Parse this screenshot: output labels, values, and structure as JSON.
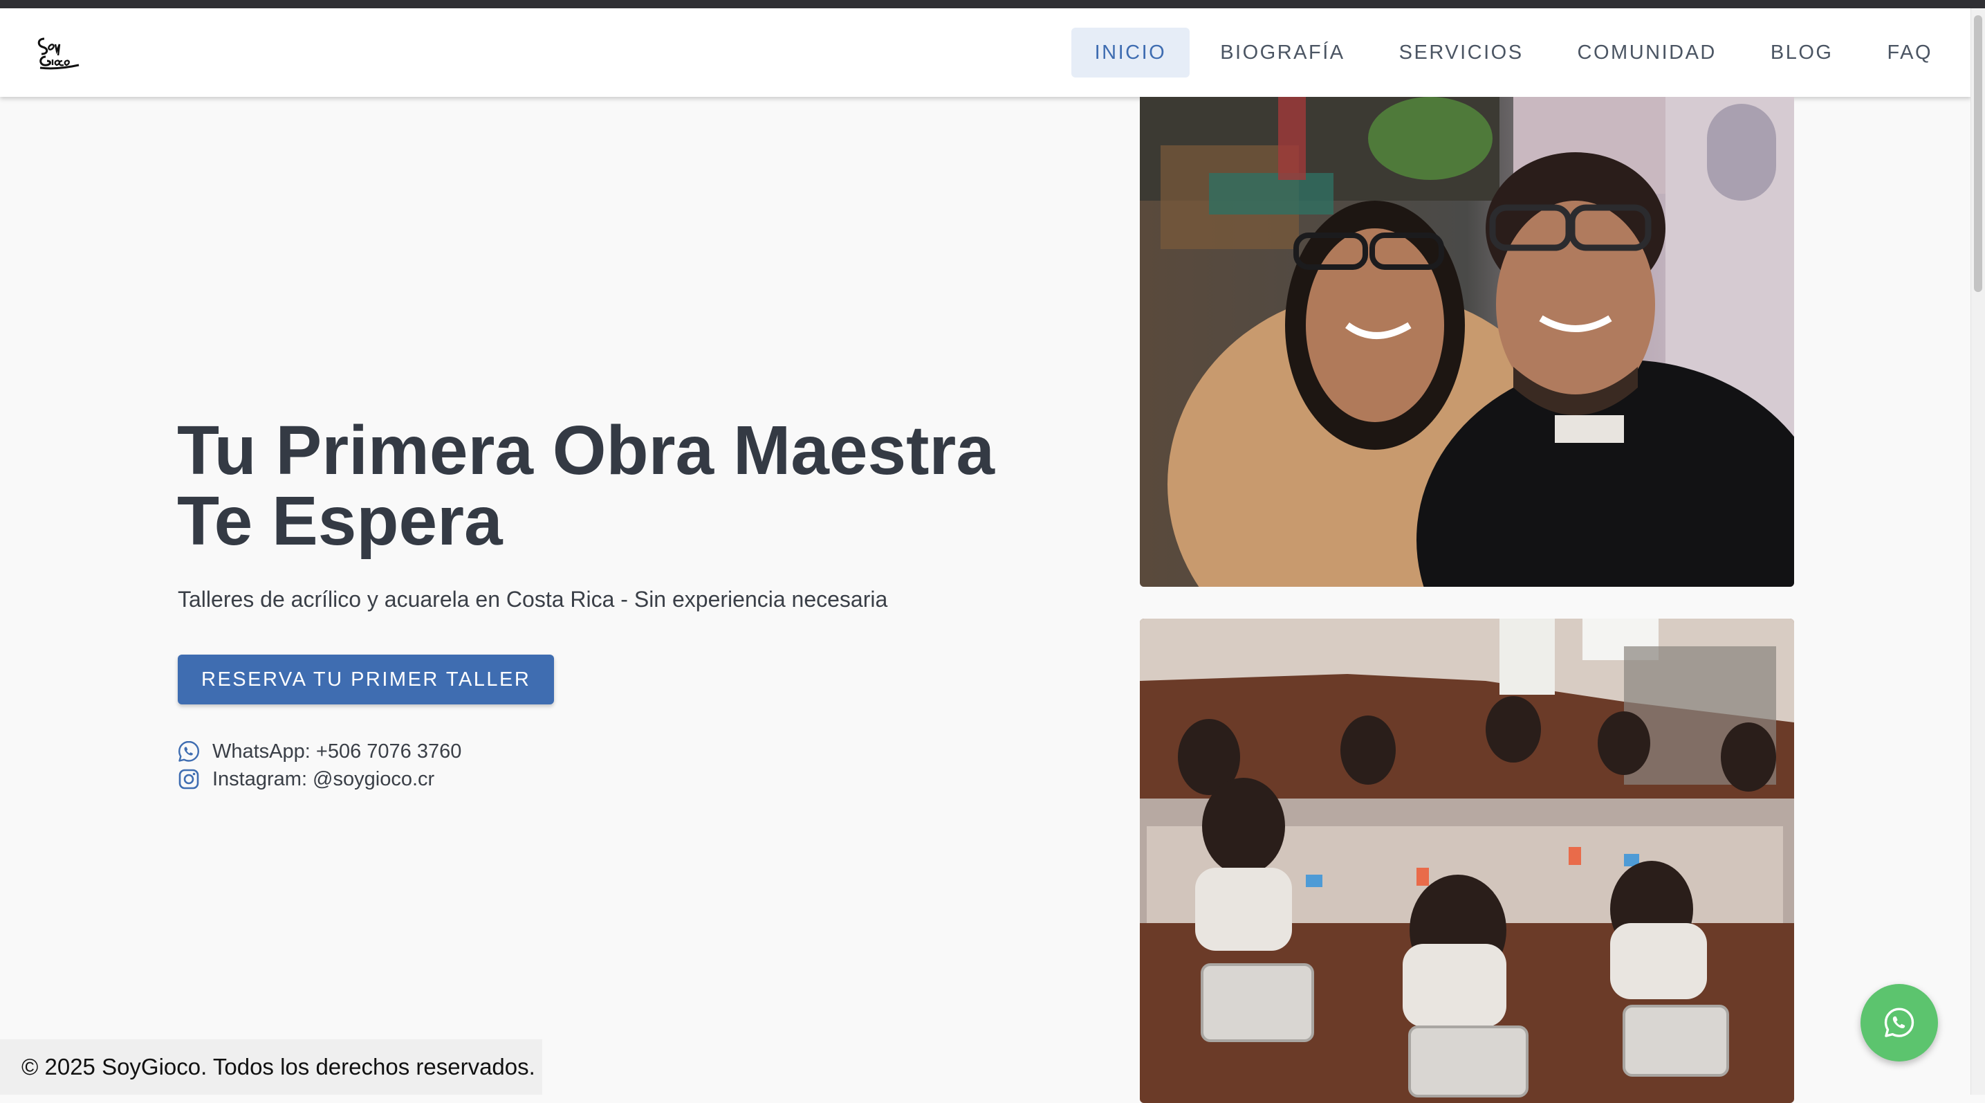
{
  "brand": {
    "logo_text": "SoyGioco"
  },
  "nav": {
    "items": [
      {
        "label": "INICIO",
        "active": true
      },
      {
        "label": "BIOGRAFÍA"
      },
      {
        "label": "SERVICIOS"
      },
      {
        "label": "COMUNIDAD"
      },
      {
        "label": "BLOG"
      },
      {
        "label": "FAQ"
      }
    ]
  },
  "hero": {
    "title_line1": "Tu Primera Obra Maestra",
    "title_line2": "Te Espera",
    "subtitle": "Talleres de acrílico y acuarela en Costa Rica - Sin experiencia necesaria",
    "cta_label": "RESERVA TU PRIMER TALLER",
    "contact": {
      "whatsapp": "WhatsApp: +506 7076 3760",
      "instagram": "Instagram: @soygioco.cr"
    }
  },
  "footer": {
    "copyright": "© 2025 SoyGioco. Todos los derechos reservados."
  },
  "colors": {
    "accent": "#3f6db1",
    "nav_active_bg": "#e6edf7",
    "whatsapp_green": "#5cc46e",
    "text": "#343a44"
  },
  "icons": {
    "whatsapp": "whatsapp-icon",
    "instagram": "instagram-icon",
    "float": "whatsapp-icon"
  }
}
